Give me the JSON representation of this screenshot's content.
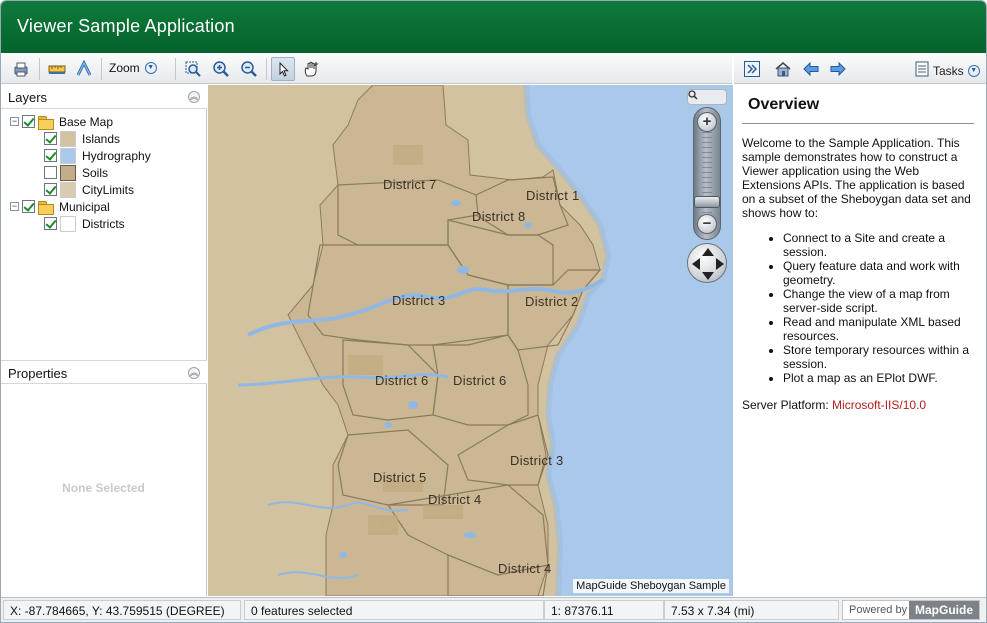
{
  "app": {
    "title": "Viewer Sample Application"
  },
  "toolbar": {
    "zoom_label": "Zoom",
    "icons": [
      "print-icon",
      "measure-icon",
      "buffer-icon",
      "zoom-rectangle-icon",
      "zoom-in-icon",
      "zoom-out-icon",
      "select-icon",
      "pan-icon"
    ]
  },
  "task_toolbar": {
    "tasks_label": "Tasks",
    "icons": [
      "expand-icon",
      "home-icon",
      "back-icon",
      "forward-icon",
      "tasks-icon"
    ]
  },
  "layers": {
    "title": "Layers",
    "groups": [
      {
        "label": "Base Map",
        "checked": true,
        "items": [
          {
            "label": "Islands",
            "checked": true,
            "color": "#d3c29f"
          },
          {
            "label": "Hydrography",
            "checked": true,
            "color": "#a9c8ea"
          },
          {
            "label": "Soils",
            "checked": false,
            "color": "#c4ad8a"
          },
          {
            "label": "CityLimits",
            "checked": true,
            "color": "#d8cbb0"
          }
        ]
      },
      {
        "label": "Municipal",
        "checked": true,
        "items": [
          {
            "label": "Districts",
            "checked": true,
            "color": "#ffffff"
          }
        ]
      }
    ]
  },
  "properties": {
    "title": "Properties",
    "empty_text": "None Selected"
  },
  "map": {
    "caption": "MapGuide Sheboygan Sample",
    "districts": [
      "District 7",
      "District 1",
      "District 8",
      "District 3",
      "District 2",
      "District 6",
      "District 6",
      "District 3",
      "District 5",
      "District 4",
      "District 4"
    ],
    "colors": {
      "land": "#d3c29f",
      "water": "#a9c8ea",
      "river": "#8fb8e6",
      "border": "#8d7a5c"
    }
  },
  "task_pane": {
    "title": "Overview",
    "intro": "Welcome to the Sample Application. This sample demonstrates how to construct a Viewer application using the Web Extensions APIs. The application is based on a subset of the Sheboygan data set and shows how to:",
    "bullets": [
      "Connect to a Site and create a session.",
      "Query feature data and work with geometry.",
      "Change the view of a map from server-side script.",
      "Read and manipulate XML based resources.",
      "Store temporary resources within a session.",
      "Plot a map as an EPlot DWF."
    ],
    "server_label": "Server Platform:",
    "server_value": "Microsoft-IIS/10.0"
  },
  "status": {
    "coords": "X: -87.784665, Y: 43.759515 (DEGREE)",
    "selection": "0 features selected",
    "scale": "1: 87376.11",
    "size": "7.53 x 7.34 (mi)",
    "powered_by": "Powered by",
    "brand": "MapGuide"
  }
}
